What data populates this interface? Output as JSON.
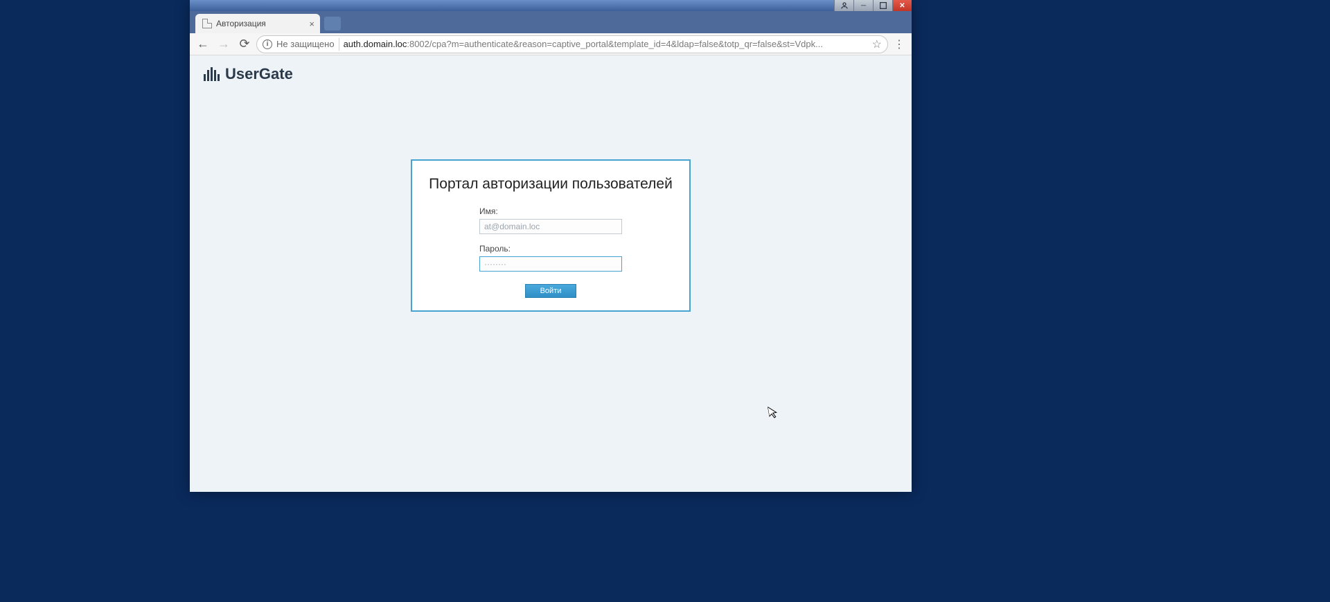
{
  "window": {
    "tab_title": "Авторизация"
  },
  "browser": {
    "security_label": "Не защищено",
    "url_host": "auth.domain.loc",
    "url_port": ":8002",
    "url_path": "/cpa?m=authenticate&reason=captive_portal&template_id=4&ldap=false&totp_qr=false&st=Vdpk..."
  },
  "page": {
    "logo_text": "UserGate",
    "auth": {
      "title": "Портал авторизации пользователей",
      "name_label": "Имя:",
      "name_value": "at@domain.loc",
      "password_label": "Пароль:",
      "password_value": "········",
      "login_button": "Войти"
    }
  }
}
